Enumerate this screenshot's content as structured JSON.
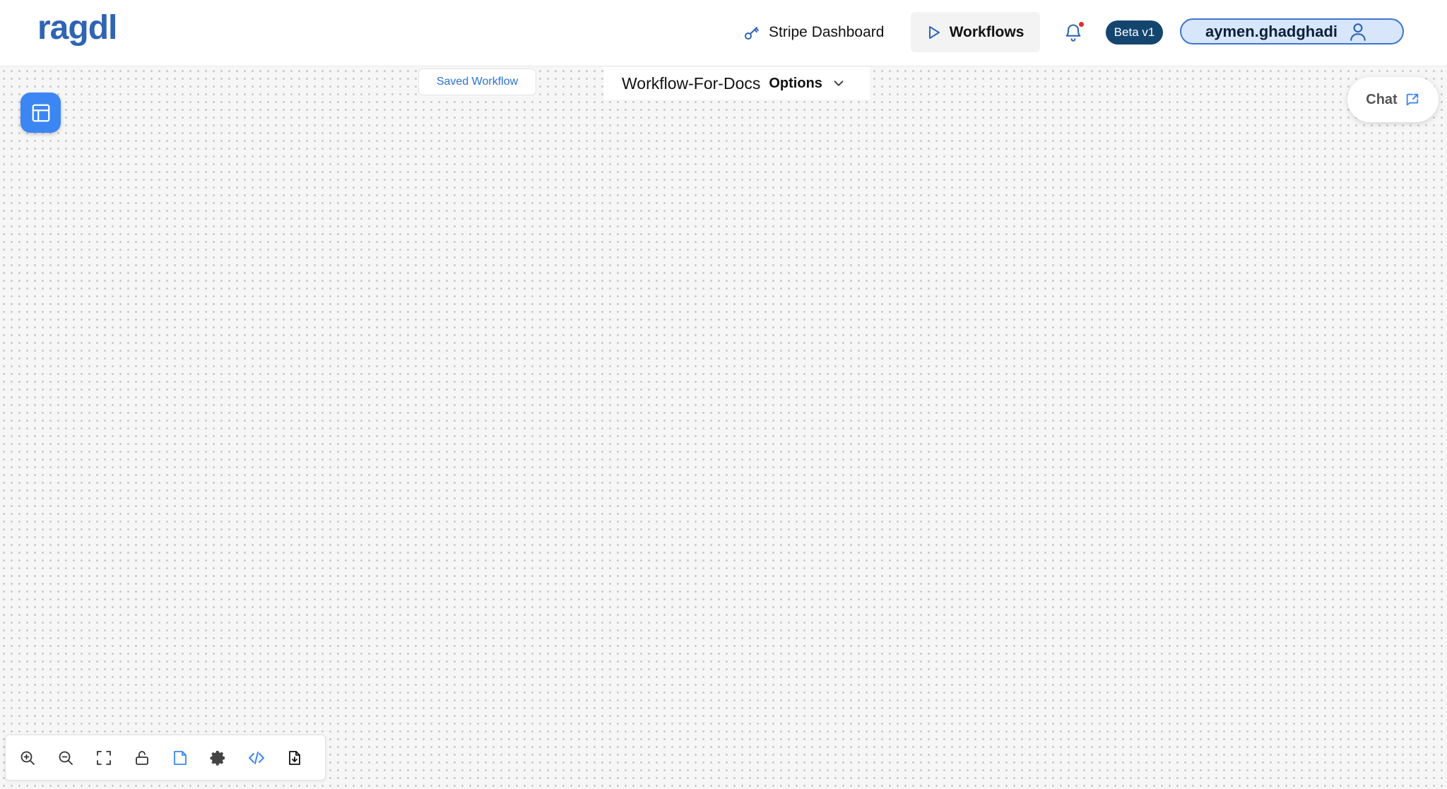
{
  "app": {
    "logo_text": "ragdl"
  },
  "nav": {
    "stripe_label": "Stripe Dashboard",
    "workflows_label": "Workflows",
    "beta_label": "Beta v1",
    "username": "aymen.ghadghadi"
  },
  "workflow": {
    "saved_status": "Saved Workflow",
    "name": "Workflow-For-Docs",
    "options_label": "Options"
  },
  "chat": {
    "label": "Chat"
  },
  "toolbar": {
    "tools": [
      "zoom-in-icon",
      "zoom-out-icon",
      "fit-view-icon",
      "unlock-icon",
      "note-icon",
      "settings-icon",
      "code-icon",
      "export-file-icon"
    ]
  },
  "colors": {
    "brand": "#2f64b4",
    "accent": "#3b86f2",
    "beta_badge": "#14456f",
    "notification_dot": "#e22d2d"
  }
}
